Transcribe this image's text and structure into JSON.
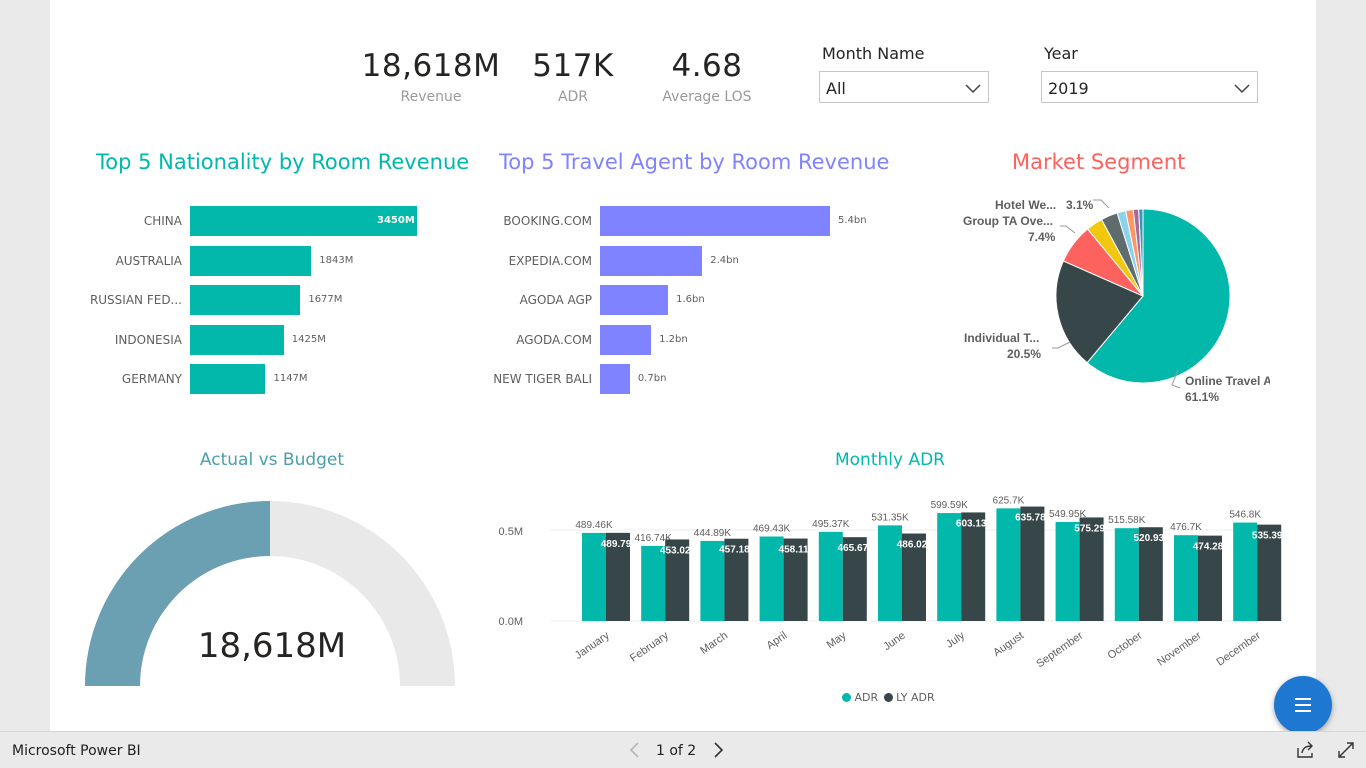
{
  "kpis": [
    {
      "value": "18,618M",
      "label": "Revenue"
    },
    {
      "value": "517K",
      "label": "ADR"
    },
    {
      "value": "4.68",
      "label": "Average LOS"
    }
  ],
  "slicers": {
    "month": {
      "title": "Month Name",
      "value": "All"
    },
    "year": {
      "title": "Year",
      "value": "2019"
    }
  },
  "colors": {
    "teal": "#01b8aa",
    "dark": "#374649",
    "purple": "#8083ff",
    "red": "#fd625e",
    "gauge": "#6aa0b1",
    "gauge_bg": "#e9e9e9",
    "slate": "#4a9fab"
  },
  "nationality": {
    "title": "Top 5 Nationality by Room Revenue",
    "categories": [
      "CHINA",
      "AUSTRALIA",
      "RUSSIAN FED...",
      "INDONESIA",
      "GERMANY"
    ],
    "labels": [
      "3450M",
      "1843M",
      "1677M",
      "1425M",
      "1147M"
    ]
  },
  "agents": {
    "title": "Top 5 Travel Agent by Room Revenue",
    "categories": [
      "BOOKING.COM",
      "EXPEDIA.COM",
      "AGODA AGP",
      "AGODA.COM",
      "NEW TIGER BALI"
    ],
    "labels": [
      "5.4bn",
      "2.4bn",
      "1.6bn",
      "1.2bn",
      "0.7bn"
    ]
  },
  "segment": {
    "title": "Market Segment",
    "labels": [
      {
        "name": "Hotel We...",
        "pct": "3.1%"
      },
      {
        "name": "Group TA Ove...",
        "pct": "7.4%"
      },
      {
        "name": "Individual T...",
        "pct": "20.5%"
      },
      {
        "name": "Online Travel Agent",
        "pct": "61.1%"
      }
    ]
  },
  "gauge": {
    "title": "Actual vs Budget",
    "value": "18,618M",
    "fill_fraction": 0.5
  },
  "monthly": {
    "title": "Monthly ADR",
    "y_ticks": [
      "0.5M",
      "0.0M"
    ],
    "legend": [
      "ADR",
      "LY ADR"
    ]
  },
  "footer": {
    "app_name": "Microsoft Power BI",
    "page": "1 of 2"
  },
  "chart_data": [
    {
      "type": "bar",
      "title": "Top 5 Nationality by Room Revenue",
      "categories": [
        "CHINA",
        "AUSTRALIA",
        "RUSSIAN FED...",
        "INDONESIA",
        "GERMANY"
      ],
      "values": [
        3450,
        1843,
        1677,
        1425,
        1147
      ],
      "unit": "M",
      "orientation": "horizontal"
    },
    {
      "type": "bar",
      "title": "Top 5 Travel Agent by Room Revenue",
      "categories": [
        "BOOKING.COM",
        "EXPEDIA.COM",
        "AGODA AGP",
        "AGODA.COM",
        "NEW TIGER BALI"
      ],
      "values": [
        5.4,
        2.4,
        1.6,
        1.2,
        0.7
      ],
      "unit": "bn",
      "orientation": "horizontal"
    },
    {
      "type": "pie",
      "title": "Market Segment",
      "slices": [
        {
          "name": "Online Travel Agent",
          "value": 61.1,
          "color": "#01b8aa"
        },
        {
          "name": "Individual T...",
          "value": 20.5,
          "color": "#374649"
        },
        {
          "name": "Group TA Ove...",
          "value": 7.4,
          "color": "#fd625e"
        },
        {
          "value": 3.1,
          "color": "#f2c80f"
        },
        {
          "name": "Hotel We...",
          "value": 3.1,
          "color": "#5f6b6d"
        },
        {
          "value": 1.6,
          "color": "#8ad4eb"
        },
        {
          "value": 1.4,
          "color": "#fe9666"
        },
        {
          "value": 1.0,
          "color": "#a66999"
        },
        {
          "value": 0.8,
          "color": "#3599b8"
        }
      ]
    },
    {
      "type": "bar",
      "title": "Monthly ADR",
      "categories": [
        "January",
        "February",
        "March",
        "April",
        "May",
        "June",
        "July",
        "August",
        "September",
        "October",
        "November",
        "December"
      ],
      "series": [
        {
          "name": "ADR",
          "values": [
            489.46,
            416.74,
            444.89,
            469.43,
            495.37,
            531.35,
            599.59,
            625.7,
            549.95,
            515.58,
            476.7,
            546.8
          ],
          "labels": [
            "489.46K",
            "416.74K",
            "444.89K",
            "469.43K",
            "495.37K",
            "531.35K",
            "599.59K",
            "625.7K",
            "549.95K",
            "515.58K",
            "476.7K",
            "546.8K"
          ],
          "color": "#01b8aa"
        },
        {
          "name": "LY ADR",
          "values": [
            489.79,
            453.02,
            457.18,
            458.11,
            465.67,
            486.02,
            603.13,
            635.78,
            575.29,
            520.93,
            474.28,
            535.39
          ],
          "labels": [
            "489.79",
            "453.02",
            "457.18",
            "458.11",
            "465.67",
            "486.02",
            "603.13",
            "635.78",
            "575.29",
            "520.93",
            "474.28",
            "535.39"
          ],
          "color": "#374649"
        }
      ],
      "unit": "K",
      "ylim": [
        0,
        700
      ],
      "yticks": [
        "0.0M",
        "0.5M"
      ]
    }
  ]
}
